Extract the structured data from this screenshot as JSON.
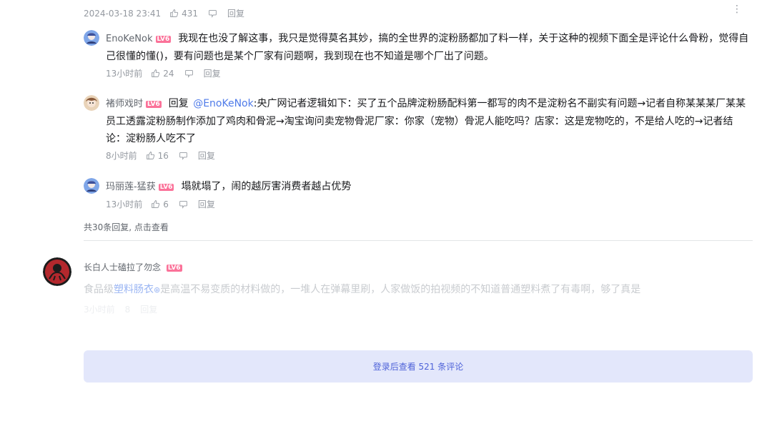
{
  "top": {
    "time": "2024-03-18 23:41",
    "likes": "431",
    "reply": "回复",
    "more": "⋮"
  },
  "replies": [
    {
      "user": "EnoKeNok",
      "level": "LV6",
      "text": "我现在也没了解这事，我只是觉得莫名其妙，搞的全世界的淀粉肠都加了料一样，关于这种的视频下面全是评论什么骨粉，觉得自己很懂的懂()，要有问题也是某个厂家有问题啊，我到现在也不知道是哪个厂出了问题。",
      "time": "13小时前",
      "likes": "24",
      "reply": "回复"
    },
    {
      "user": "褚师戏时",
      "level": "LV6",
      "reply_word": "回复",
      "at": "@EnoKeNok",
      "text": ":央广网记者逻辑如下：买了五个品牌淀粉肠配料第一都写的肉不是淀粉名不副实有问题→记者自称某某某厂某某员工透露淀粉肠制作添加了鸡肉和骨泥→淘宝询问卖宠物骨泥厂家：你家（宠物）骨泥人能吃吗？店家：这是宠物吃的，不是给人吃的→记者结论：淀粉肠人吃不了",
      "time": "8小时前",
      "likes": "16",
      "reply": "回复"
    },
    {
      "user": "玛丽莲-猛获",
      "level": "LV6",
      "text": "塌就塌了，闹的越厉害消费者越占优势",
      "time": "13小时前",
      "likes": "6",
      "reply": "回复"
    }
  ],
  "more_replies": "共30条回复, 点击查看",
  "main_comment": {
    "user": "长白人士磕拉了勿念",
    "level": "LV6",
    "text_pre": "食品级",
    "keyword": "塑料肠衣",
    "text_post": "是高温不易变质的材料做的，一堆人在弹幕里刷，人家做饭的拍视频的不知道普通塑料煮了有毒啊，够了真是",
    "time": "3小时前",
    "likes": "8",
    "reply": "回复"
  },
  "login_bar": "登录后查看 521 条评论",
  "colors": {
    "level_badge": "#fb7299",
    "link": "#4f7be9",
    "login_bg": "#e3e7fb",
    "login_text": "#4f63d9"
  }
}
